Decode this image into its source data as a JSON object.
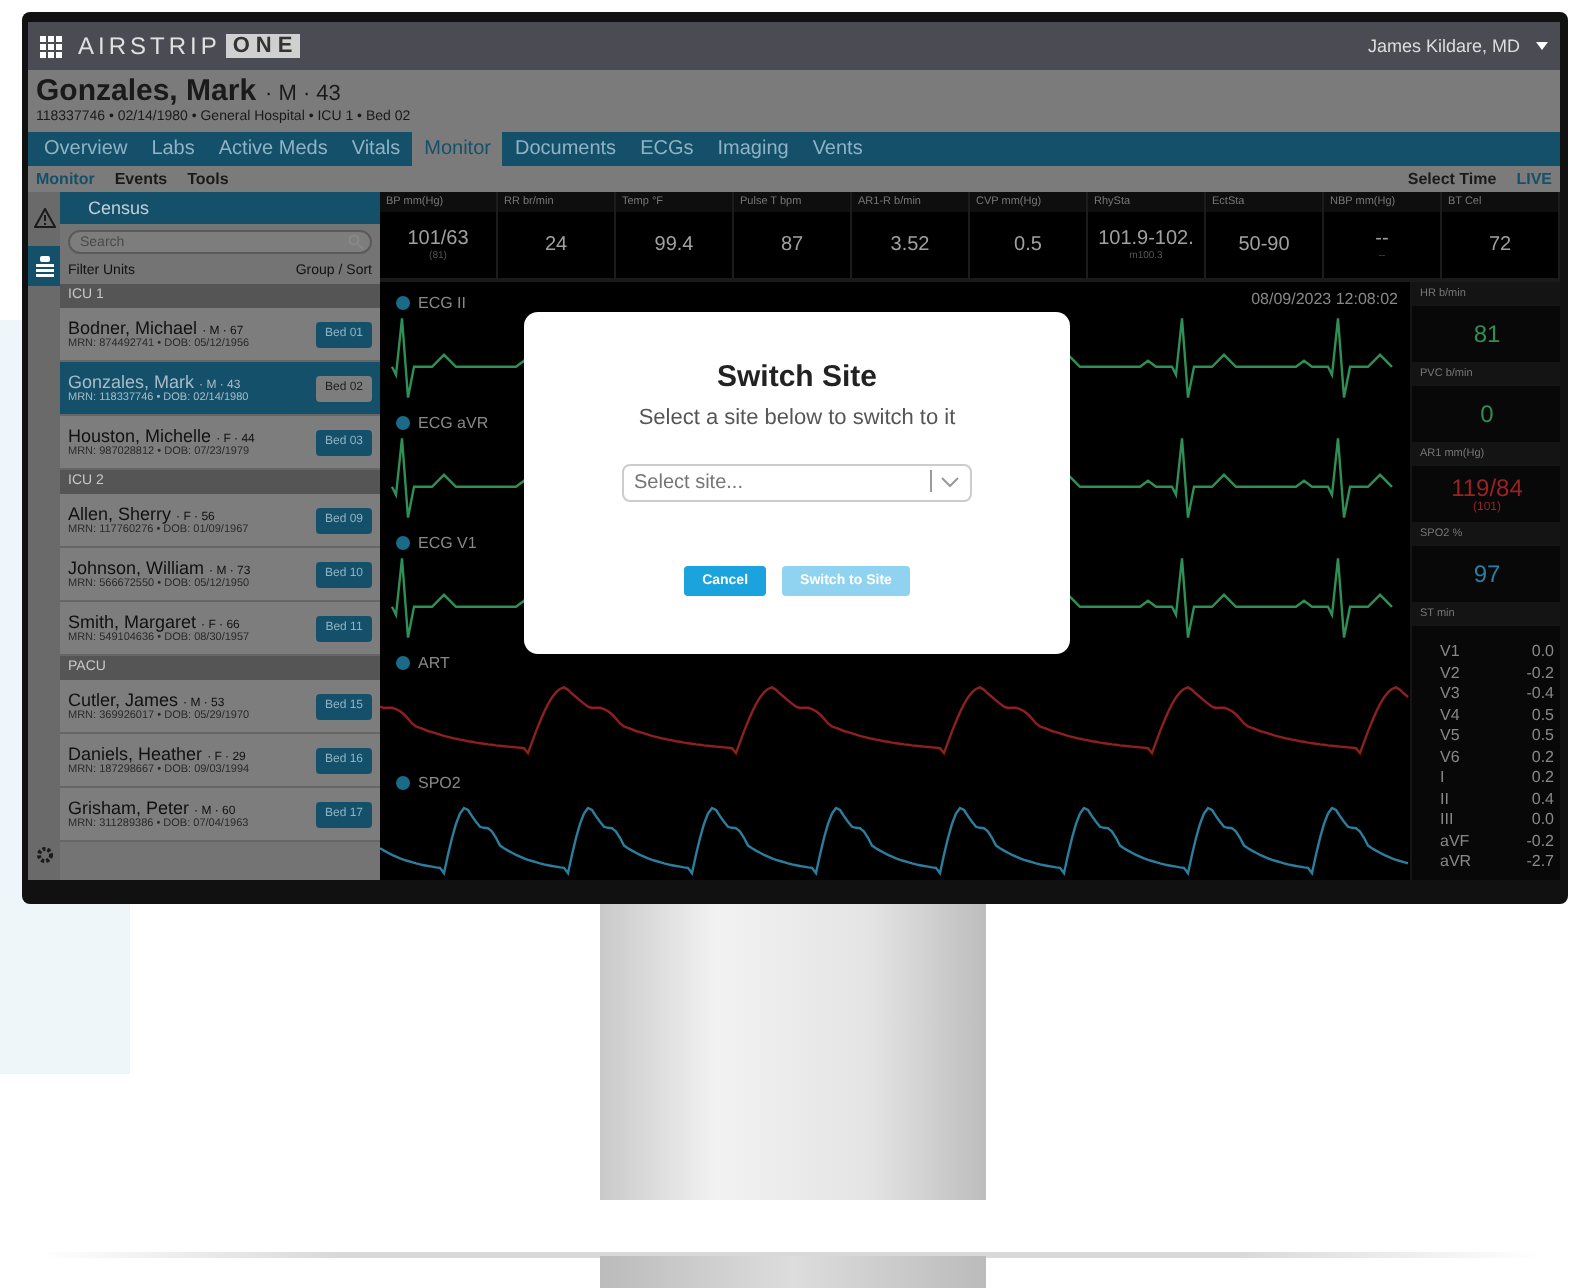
{
  "top_bar": {
    "logo_main": "AIRSTRIP",
    "logo_boxed": "ONE",
    "user": "James Kildare, MD"
  },
  "patient": {
    "name": "Gonzales, Mark",
    "sex_age": "· M · 43",
    "details": "118337746 • 02/14/1980 • General Hospital • ICU 1 • Bed 02"
  },
  "tabs": [
    {
      "label": "Overview",
      "selected": false
    },
    {
      "label": "Labs",
      "selected": false
    },
    {
      "label": "Active Meds",
      "selected": false
    },
    {
      "label": "Vitals",
      "selected": false
    },
    {
      "label": "Monitor",
      "selected": true
    },
    {
      "label": "Documents",
      "selected": false
    },
    {
      "label": "ECGs",
      "selected": false
    },
    {
      "label": "Imaging",
      "selected": false
    },
    {
      "label": "Vents",
      "selected": false
    }
  ],
  "subtabs": [
    {
      "label": "Monitor",
      "selected": true
    },
    {
      "label": "Events",
      "selected": false
    },
    {
      "label": "Tools",
      "selected": false
    }
  ],
  "select_time": "Select Time",
  "live": "LIVE",
  "census": {
    "title": "Census",
    "search_placeholder": "Search",
    "filter": "Filter Units",
    "group_sort": "Group / Sort",
    "groups": [
      {
        "name": "ICU 1",
        "patients": [
          {
            "name": "Bodner, Michael",
            "sex_age": "· M · 67",
            "ids": "MRN: 874492741 • DOB: 05/12/1956",
            "bed": "Bed 01",
            "selected": false
          },
          {
            "name": "Gonzales, Mark",
            "sex_age": "· M · 43",
            "ids": "MRN: 118337746 • DOB: 02/14/1980",
            "bed": "Bed 02",
            "selected": true
          },
          {
            "name": "Houston, Michelle",
            "sex_age": "· F · 44",
            "ids": "MRN: 987028812 • DOB: 07/23/1979",
            "bed": "Bed 03",
            "selected": false
          }
        ]
      },
      {
        "name": "ICU 2",
        "patients": [
          {
            "name": "Allen, Sherry",
            "sex_age": "· F · 56",
            "ids": "MRN: 117760276 • DOB: 01/09/1967",
            "bed": "Bed 09",
            "selected": false
          },
          {
            "name": "Johnson, William",
            "sex_age": "· M · 73",
            "ids": "MRN: 566672550 • DOB: 05/12/1950",
            "bed": "Bed 10",
            "selected": false
          },
          {
            "name": "Smith, Margaret",
            "sex_age": "· F · 66",
            "ids": "MRN: 549104636 • DOB: 08/30/1957",
            "bed": "Bed 11",
            "selected": false
          }
        ]
      },
      {
        "name": "PACU",
        "patients": [
          {
            "name": "Cutler, James",
            "sex_age": "· M · 53",
            "ids": "MRN: 369926017 • DOB: 05/29/1970",
            "bed": "Bed 15",
            "selected": false
          },
          {
            "name": "Daniels, Heather",
            "sex_age": "· F · 29",
            "ids": "MRN: 187298667 • DOB: 09/03/1994",
            "bed": "Bed 16",
            "selected": false
          },
          {
            "name": "Grisham, Peter",
            "sex_age": "· M · 60",
            "ids": "MRN: 311289386 • DOB: 07/04/1963",
            "bed": "Bed 17",
            "selected": false
          }
        ]
      }
    ]
  },
  "vitals": [
    {
      "label": "BP mm(Hg)",
      "value": "101/63",
      "sub": "(81)"
    },
    {
      "label": "RR br/min",
      "value": "24"
    },
    {
      "label": "Temp °F",
      "value": "99.4"
    },
    {
      "label": "Pulse T bpm",
      "value": "87"
    },
    {
      "label": "AR1-R b/min",
      "value": "3.52"
    },
    {
      "label": "CVP mm(Hg)",
      "value": "0.5"
    },
    {
      "label": "RhySta",
      "value": "101.9-102.",
      "sub": "m100.3"
    },
    {
      "label": "EctSta",
      "value": "50-90"
    },
    {
      "label": "NBP mm(Hg)",
      "value": "--",
      "sub": "--"
    },
    {
      "label": "BT Cel",
      "value": "72"
    }
  ],
  "timestamp": "08/09/2023  12:08:02",
  "waves": [
    {
      "label": "ECG II",
      "kind": "ecg",
      "color": "#2f8f55"
    },
    {
      "label": "ECG aVR",
      "kind": "ecg",
      "color": "#2f8f55"
    },
    {
      "label": "ECG V1",
      "kind": "ecg",
      "color": "#2f8f55"
    },
    {
      "label": "ART",
      "kind": "art",
      "color": "#8f2020"
    },
    {
      "label": "SPO2",
      "kind": "pleth",
      "color": "#2a7f9f"
    }
  ],
  "side_vitals": [
    {
      "label": "HR b/min",
      "value": "81",
      "color": "#2f8f55"
    },
    {
      "label": "PVC b/min",
      "value": "0",
      "color": "#2f8f55"
    },
    {
      "label": "AR1 mm(Hg)",
      "value": "119/84",
      "sub": "(101)",
      "color": "#9a2222"
    },
    {
      "label": "SPO2 %",
      "value": "97",
      "color": "#2a7f9f"
    }
  ],
  "st": {
    "label": "ST min",
    "rows": [
      {
        "lead": "V1",
        "value": "0.0"
      },
      {
        "lead": "V2",
        "value": "-0.2"
      },
      {
        "lead": "V3",
        "value": "-0.4"
      },
      {
        "lead": "V4",
        "value": "0.5"
      },
      {
        "lead": "V5",
        "value": "0.5"
      },
      {
        "lead": "V6",
        "value": "0.2"
      },
      {
        "lead": "I",
        "value": "0.2"
      },
      {
        "lead": "II",
        "value": "0.4"
      },
      {
        "lead": "III",
        "value": "0.0"
      },
      {
        "lead": "aVF",
        "value": "-0.2"
      },
      {
        "lead": "aVR",
        "value": "-2.7"
      }
    ]
  },
  "dialog": {
    "title": "Switch Site",
    "subtitle": "Select a site below to switch to it",
    "select_placeholder": "Select site...",
    "buttons": [
      {
        "label": "Cancel",
        "disabled": false
      },
      {
        "label": "Switch to Site",
        "disabled": true
      }
    ]
  }
}
